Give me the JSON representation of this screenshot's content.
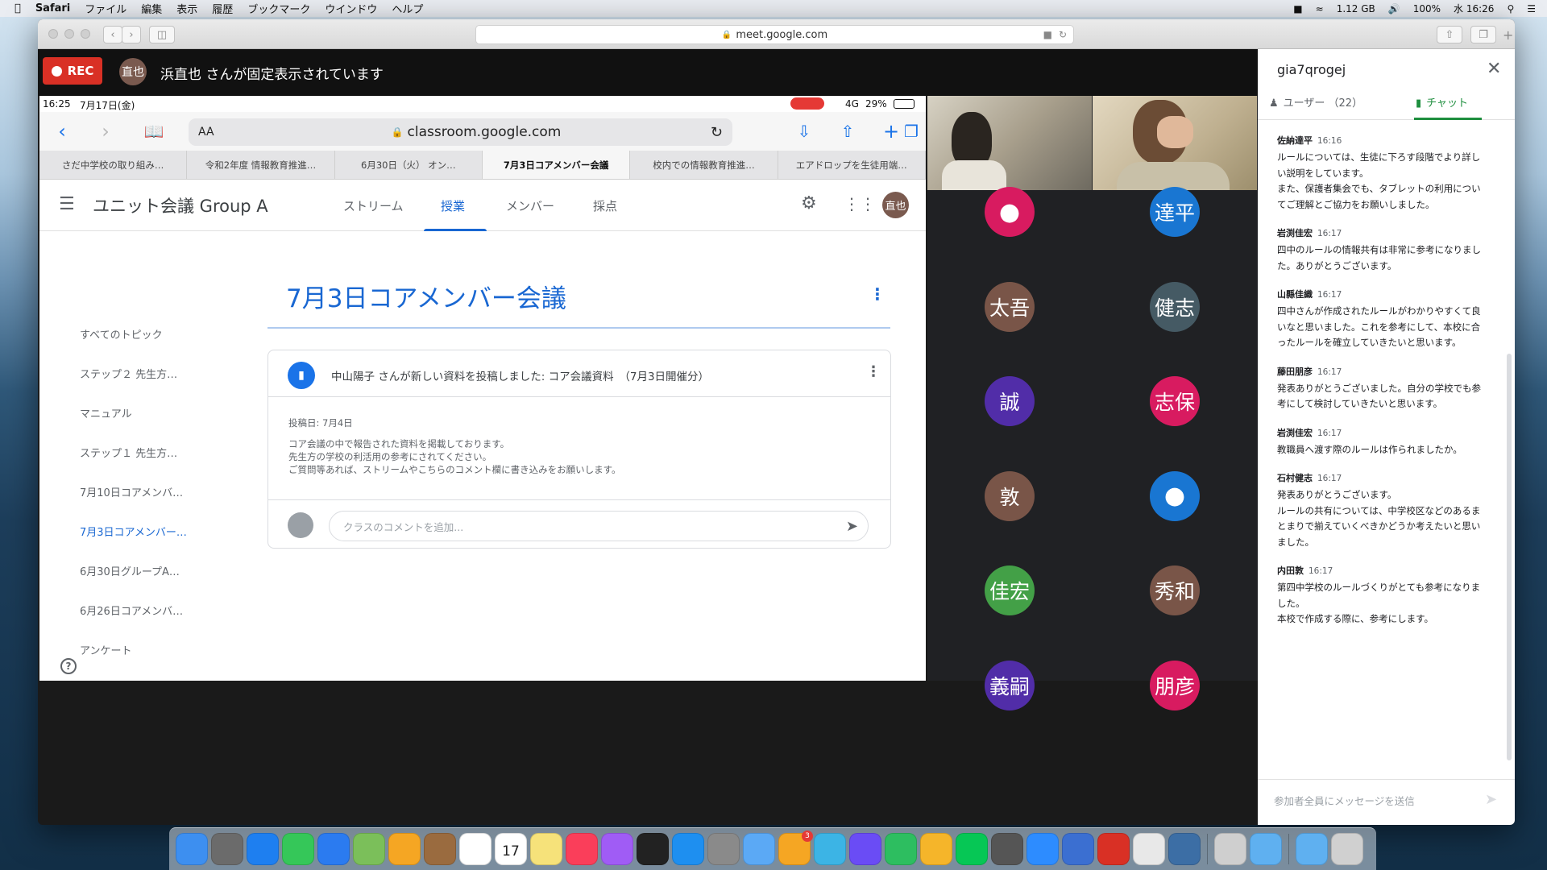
{
  "menubar": {
    "app": "Safari",
    "items": [
      "ファイル",
      "編集",
      "表示",
      "履歴",
      "ブックマーク",
      "ウインドウ",
      "ヘルプ"
    ],
    "memory": "1.12 GB",
    "battery": "100%",
    "clock": "水 16:26"
  },
  "browser": {
    "address": "meet.google.com"
  },
  "meet": {
    "rec_label": "REC",
    "pinned_initials": "直也",
    "pinned_text": "浜直也 さんが固定表示されています"
  },
  "ipad": {
    "status_time": "16:25",
    "status_date": "7月17日(金)",
    "status_signal": "4G",
    "status_battery": "29%",
    "url_aa": "AA",
    "url": "classroom.google.com",
    "tabs": [
      "さだ中学校の取り組み…",
      "令和2年度 情報教育推進…",
      "6月30日（火） オン…",
      "7月3日コアメンバー会議",
      "校内での情報教育推進…",
      "エアドロップを生徒用端…"
    ]
  },
  "classroom": {
    "class_name": "ユニット会議 Group A",
    "nav": [
      "ストリーム",
      "授業",
      "メンバー",
      "採点"
    ],
    "user_initials": "直也",
    "topics": [
      "すべてのトピック",
      "ステップ２ 先生方…",
      "マニュアル",
      "ステップ１ 先生方…",
      "7月10日コアメンバ…",
      "7月3日コアメンバー…",
      "6月30日グループA…",
      "6月26日コアメンバ…",
      "アンケート"
    ],
    "topic_title": "7月3日コアメンバー会議",
    "card": {
      "title": "中山陽子 さんが新しい資料を投稿しました: コア会議資料　（7月3日開催分）",
      "date": "投稿日: 7月4日",
      "lines": [
        "コア会議の中で報告された資料を掲載しております。",
        "先生方の学校の利活用の参考にされてください。",
        "ご質問等あれば、ストリームやこちらのコメント欄に書き込みをお願いします。"
      ],
      "comment_placeholder": "クラスのコメントを追加..."
    },
    "help": "?"
  },
  "participants": [
    {
      "label": "",
      "color": "#d81b60"
    },
    {
      "label": "達平",
      "color": "#1976d2"
    },
    {
      "label": "太吾",
      "color": "#795548"
    },
    {
      "label": "健志",
      "color": "#455a64"
    },
    {
      "label": "誠",
      "color": "#512da8"
    },
    {
      "label": "志保",
      "color": "#d81b60"
    },
    {
      "label": "敦",
      "color": "#795548"
    },
    {
      "label": "",
      "color": "#1976d2"
    },
    {
      "label": "佳宏",
      "color": "#43a047"
    },
    {
      "label": "秀和",
      "color": "#795548"
    },
    {
      "label": "義嗣",
      "color": "#512da8"
    },
    {
      "label": "朋彦",
      "color": "#d81b60"
    }
  ],
  "chat": {
    "meeting_code": "gia7qrogej",
    "tab_users": "ユーザー （22）",
    "tab_chat": "チャット",
    "input_placeholder": "参加者全員にメッセージを送信",
    "messages": [
      {
        "sender": "佐納達平",
        "time": "16:16",
        "text": "ルールについては、生徒に下ろす段階でより詳しい説明をしています。\nまた、保護者集会でも、タブレットの利用についてご理解とご協力をお願いしました。"
      },
      {
        "sender": "岩渕佳宏",
        "time": "16:17",
        "text": "四中のルールの情報共有は非常に参考になりました。ありがとうございます。"
      },
      {
        "sender": "山縣佳織",
        "time": "16:17",
        "text": "四中さんが作成されたルールがわかりやすくて良いなと思いました。これを参考にして、本校に合ったルールを確立していきたいと思います。"
      },
      {
        "sender": "藤田朋彦",
        "time": "16:17",
        "text": "発表ありがとうございました。自分の学校でも参考にして検討していきたいと思います。"
      },
      {
        "sender": "岩渕佳宏",
        "time": "16:17",
        "text": "教職員へ渡す際のルールは作られましたか。"
      },
      {
        "sender": "石村健志",
        "time": "16:17",
        "text": "発表ありがとうございます。\nルールの共有については、中学校区などのあるまとまりで揃えていくべきかどうか考えたいと思いました。"
      },
      {
        "sender": "内田敦",
        "time": "16:17",
        "text": "第四中学校のルールづくりがとても参考になりました。\n本校で作成する際に、参考にします。"
      }
    ]
  },
  "dock": {
    "badge_count": "3",
    "calendar_day": "17",
    "icon_colors": [
      "#3d8ff0",
      "#6b6b6b",
      "#1e7ff0",
      "#35c759",
      "#2b7bf0",
      "#7bbf5a",
      "#f5a623",
      "#9a6b3f",
      "#ffffff",
      "#ffffff",
      "#f6e27a",
      "#fa3e5a",
      "#a05cf5",
      "#222222",
      "#1e8ff0",
      "#8a8a8a",
      "#5ba9f5",
      "#f5a623",
      "#3cb4e5",
      "#6a4cf5",
      "#2dbe60",
      "#f5b52a",
      "#06c755",
      "#555555",
      "#2d8cff",
      "#3b6fd1",
      "#d93025",
      "#e8e8e8",
      "#3c6ea5",
      "#cfcfcf",
      "#5fb0f0",
      "#5fb0f0",
      "#d0d0d0"
    ]
  }
}
